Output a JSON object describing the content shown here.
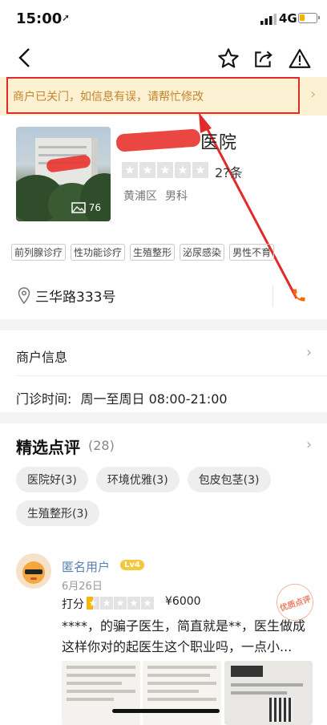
{
  "status_bar": {
    "time": "15:00",
    "network": "4G"
  },
  "banner": {
    "text": "商户已关门，如信息有误，请帮忙修改"
  },
  "business": {
    "name": "医院",
    "photo_count": "76",
    "review_count": "2?条",
    "rating_stars": 0,
    "district": "黄浦区",
    "category": "男科",
    "tags": [
      "前列腺诊疗",
      "性功能诊疗",
      "生殖整形",
      "泌尿感染",
      "男性不育"
    ],
    "address": "三华路333号"
  },
  "merchant_info": {
    "label": "商户信息"
  },
  "hours": {
    "label": "门诊时间:",
    "value": "周一至周日 08:00-21:00"
  },
  "reviews": {
    "title": "精选点评",
    "count": "(28)",
    "chips": [
      "医院好(3)",
      "环境优雅(3)",
      "包皮包茎(3)",
      "生殖整形(3)"
    ],
    "items": [
      {
        "user": "匿名用户",
        "level": "Lv4",
        "date": "6月26日",
        "rating_label": "打分",
        "price": "¥6000",
        "text": "****，的骗子医生，简直就是**，医生做成这样你对的起医生这个职业吗，一点小...",
        "stamp": "优质点评"
      }
    ]
  },
  "colors": {
    "accent": "#ff6600",
    "banner_bg": "#fdf1d4",
    "banner_text": "#c4832a",
    "annotation": "#e22a2a"
  }
}
